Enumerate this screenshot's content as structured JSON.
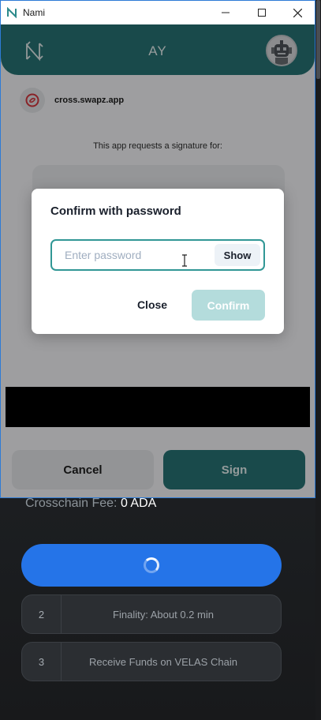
{
  "window": {
    "title": "Nami"
  },
  "header": {
    "account_name": "AY"
  },
  "origin": {
    "host": "cross.swapz.app"
  },
  "request": {
    "text": "This app requests a signature for:"
  },
  "actions": {
    "cancel_label": "Cancel",
    "sign_label": "Sign"
  },
  "modal": {
    "title": "Confirm with password",
    "password_placeholder": "Enter password",
    "password_value": "",
    "show_label": "Show",
    "close_label": "Close",
    "confirm_label": "Confirm"
  },
  "background": {
    "fee_label": "Crosschain Fee:",
    "fee_value": "0 ADA",
    "steps": [
      {
        "number": "2",
        "label": "Finality: About 0.2 min"
      },
      {
        "number": "3",
        "label": "Receive Funds on VELAS Chain"
      }
    ]
  },
  "colors": {
    "nami_teal": "#287576",
    "input_border": "#319795",
    "confirm_disabled": "#b4dcdc",
    "progress_blue": "#2574e8"
  },
  "icons": [
    "nami-logo-icon",
    "avatar-robot-icon",
    "swapz-favicon-icon",
    "minimize-icon",
    "maximize-icon",
    "close-icon",
    "loading-spinner-icon",
    "text-cursor-icon"
  ]
}
